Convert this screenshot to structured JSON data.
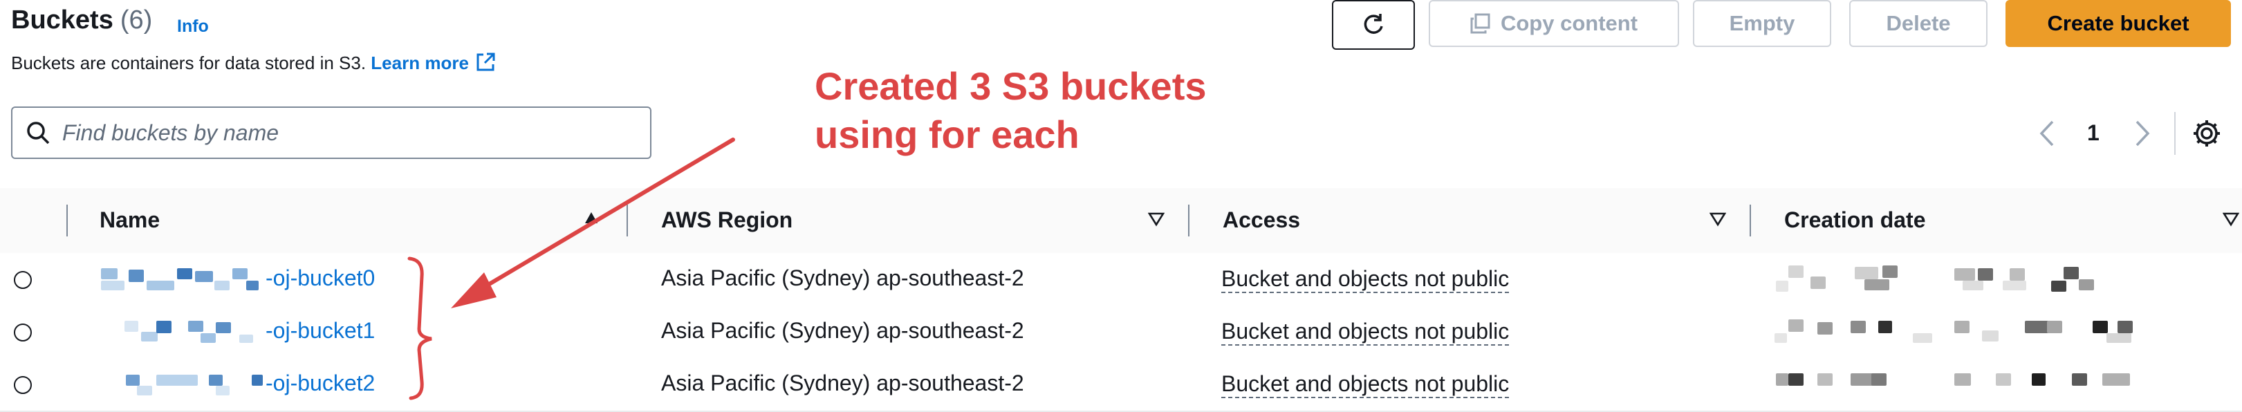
{
  "header": {
    "title": "Buckets",
    "count": "(6)",
    "info_label": "Info",
    "description": "Buckets are containers for data stored in S3.",
    "learn_more_label": "Learn more"
  },
  "toolbar": {
    "copy_label": "Copy content",
    "empty_label": "Empty",
    "delete_label": "Delete",
    "create_label": "Create bucket"
  },
  "search": {
    "placeholder": "Find buckets by name"
  },
  "pagination": {
    "current_page": "1"
  },
  "annotation": {
    "line1": "Created 3 S3 buckets",
    "line2": "using for each"
  },
  "table": {
    "columns": [
      "Name",
      "AWS Region",
      "Access",
      "Creation date"
    ],
    "rows": [
      {
        "name": "-oj-bucket0",
        "region": "Asia Pacific (Sydney) ap-southeast-2",
        "access": "Bucket and objects not public"
      },
      {
        "name": "-oj-bucket1",
        "region": "Asia Pacific (Sydney) ap-southeast-2",
        "access": "Bucket and objects not public"
      },
      {
        "name": "-oj-bucket2",
        "region": "Asia Pacific (Sydney) ap-southeast-2",
        "access": "Bucket and objects not public"
      }
    ]
  },
  "colors": {
    "primary_button": "#ec9c28",
    "link": "#0972d3",
    "annotation": "#dc4545",
    "disabled_text": "#9ba7b6"
  },
  "icons": [
    "refresh-icon",
    "copy-icon",
    "external-link-icon",
    "search-icon",
    "chevron-left-icon",
    "chevron-right-icon",
    "gear-icon",
    "sort-up-icon",
    "filter-icon",
    "annotation-arrow",
    "annotation-brace"
  ]
}
